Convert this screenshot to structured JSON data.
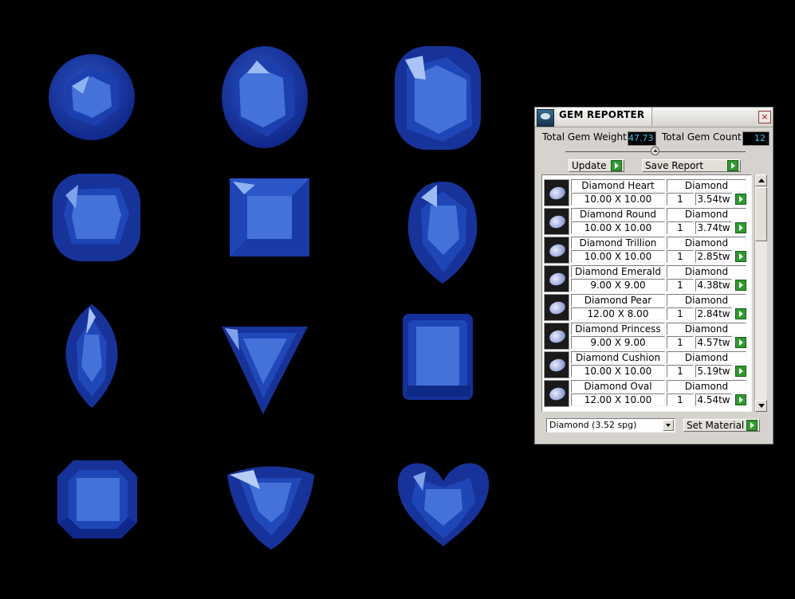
{
  "gems": [
    {
      "name": "round-gem"
    },
    {
      "name": "oval-gem"
    },
    {
      "name": "cushion-gem-large"
    },
    {
      "name": "cushion-gem"
    },
    {
      "name": "princess-gem"
    },
    {
      "name": "pear-gem"
    },
    {
      "name": "marquise-gem"
    },
    {
      "name": "trillion-gem"
    },
    {
      "name": "emerald-gem"
    },
    {
      "name": "asscher-gem"
    },
    {
      "name": "curved-trillion-gem"
    },
    {
      "name": "heart-gem"
    }
  ],
  "colors": {
    "gem_base": "#1d3fa5",
    "gem_table": "#3f6fd6",
    "gem_highlight": "#8fb2f2",
    "gem_shadow": "#0d1f66"
  },
  "panel": {
    "title": "GEM REPORTER",
    "close": "×",
    "total_weight_label": "Total Gem Weight",
    "total_weight_value": "47.73",
    "total_count_label": "Total Gem Count",
    "total_count_value": "12",
    "update_label": "Update",
    "save_report_label": "Save Report",
    "rows": [
      {
        "name": "Diamond Heart",
        "material": "Diamond",
        "dims": "10.00 X 10.00",
        "qty": "1",
        "weight": "3.54tw"
      },
      {
        "name": "Diamond Round",
        "material": "Diamond",
        "dims": "10.00 X 10.00",
        "qty": "1",
        "weight": "3.74tw"
      },
      {
        "name": "Diamond Trillion",
        "material": "Diamond",
        "dims": "10.00 X 10.00",
        "qty": "1",
        "weight": "2.85tw"
      },
      {
        "name": "Diamond Emerald",
        "material": "Diamond",
        "dims": "9.00 X 9.00",
        "qty": "1",
        "weight": "4.38tw"
      },
      {
        "name": "Diamond Pear",
        "material": "Diamond",
        "dims": "12.00 X 8.00",
        "qty": "1",
        "weight": "2.84tw"
      },
      {
        "name": "Diamond Princess",
        "material": "Diamond",
        "dims": "9.00 X 9.00",
        "qty": "1",
        "weight": "4.57tw"
      },
      {
        "name": "Diamond Cushion",
        "material": "Diamond",
        "dims": "10.00 X 10.00",
        "qty": "1",
        "weight": "5.19tw"
      },
      {
        "name": "Diamond Oval",
        "material": "Diamond",
        "dims": "12.00 X 10.00",
        "qty": "1",
        "weight": "4.54tw"
      }
    ],
    "material_select": "Diamond     (3.52 spg)",
    "set_material_label": "Set Material"
  }
}
